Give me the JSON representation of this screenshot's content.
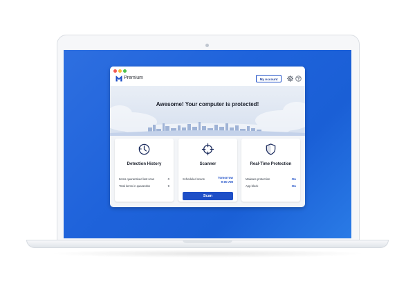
{
  "app": {
    "name": "Premium"
  },
  "toolbar": {
    "account_label": "My Account",
    "settings_icon": "gear-icon",
    "help_icon": "help-icon"
  },
  "banner": {
    "headline": "Awesome! Your computer is protected!"
  },
  "cards": {
    "detection": {
      "title": "Detection History",
      "icon": "clock-icon",
      "rows": [
        {
          "label": "Items quarantined last scan",
          "value": "0"
        },
        {
          "label": "Total items in quarantine",
          "value": "9"
        }
      ]
    },
    "scanner": {
      "title": "Scanner",
      "icon": "crosshair-icon",
      "rows": [
        {
          "label": "Scheduled scans",
          "value_line1": "Tomorrow",
          "value_line2": "9:00 AM"
        }
      ],
      "button_label": "Scan"
    },
    "protection": {
      "title": "Real-Time Protection",
      "icon": "shield-icon",
      "rows": [
        {
          "label": "Malware protection",
          "value": "On"
        },
        {
          "label": "App block",
          "value": "On"
        }
      ]
    }
  },
  "colors": {
    "accent": "#1e4fc7",
    "desktop": "#1f63db",
    "window_bg": "#f3f5f8"
  }
}
